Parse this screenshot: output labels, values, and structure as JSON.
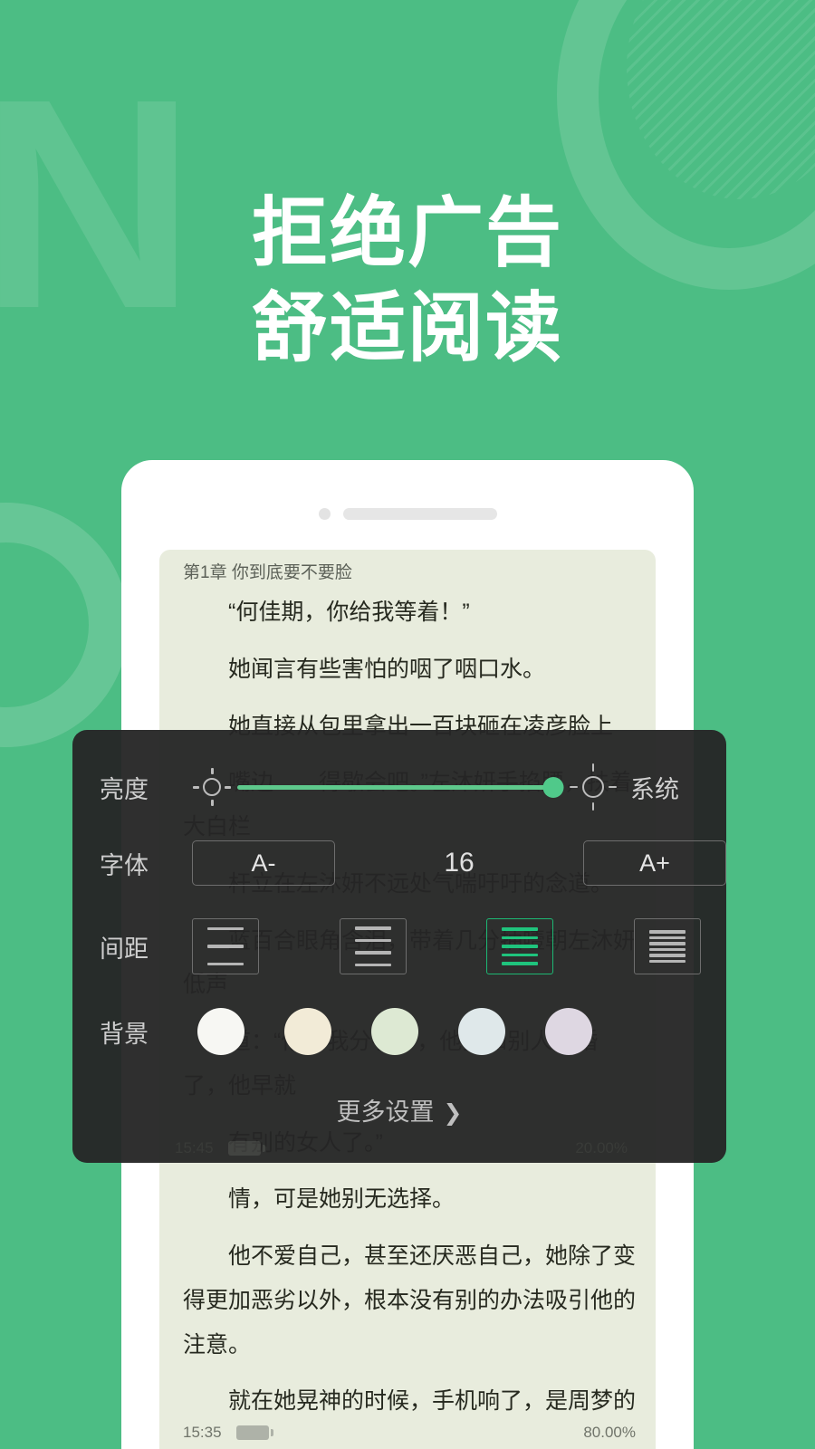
{
  "promo": {
    "headline_line1": "拒绝广告",
    "headline_line2": "舒适阅读",
    "background_color": "#4cbd84",
    "deco_letter": "N"
  },
  "reader": {
    "chapter_title": "第1章 你到底要不要脸",
    "paragraphs_top": [
      "“何佳期，你给我等着！”",
      "她闻言有些害怕的咽了咽口水。",
      "她直接从包里拿出一百块砸在凌彦脸上"
    ],
    "paragraphs_hidden": [
      "嘴边……得歇会吧。”左沐妍手掐腰，扶着大白栏",
      "杆立在左沐妍不远处气喘吁吁的念道。",
      "蓝百合眼角含泪，带着几分抽噎朝左沐妍低声",
      "道：“他和我分手了，他要和别人结婚了，他早就",
      "有别的女人了。”"
    ],
    "paragraphs_bottom": [
      "情，可是她别无选择。",
      "他不爱自己，甚至还厌恶自己，她除了变得更加恶劣以外，根本没有别的办法吸引他的注意。",
      "就在她晃神的时候，手机响了，是周梦的"
    ],
    "status": {
      "time": "15:35",
      "progress": "80.00%",
      "battery_icon": "battery-icon"
    },
    "ghost_status": {
      "time": "15:45",
      "progress": "20.00%"
    },
    "page_background_color": "#e8ecdd"
  },
  "settings_panel": {
    "brightness": {
      "label": "亮度",
      "low_icon": "sun-small-icon",
      "high_icon": "sun-large-icon",
      "value_percent": 97,
      "mode_label": "系统",
      "fill_color": "#5ec98c"
    },
    "font": {
      "label": "字体",
      "decrease_label": "A-",
      "increase_label": "A+",
      "size_value": "16"
    },
    "spacing": {
      "label": "间距",
      "options": [
        {
          "name": "spacing-loose",
          "lines": 3,
          "selected": false
        },
        {
          "name": "spacing-normal",
          "lines": 4,
          "selected": false
        },
        {
          "name": "spacing-tight",
          "lines": 5,
          "selected": true
        },
        {
          "name": "spacing-tightest",
          "lines": 6,
          "selected": false
        }
      ],
      "selected_color": "#1db874"
    },
    "background": {
      "label": "背景",
      "swatches": [
        {
          "name": "theme-white",
          "color": "#f7f7f3"
        },
        {
          "name": "theme-cream",
          "color": "#f2ebd7"
        },
        {
          "name": "theme-green",
          "color": "#dde9d3"
        },
        {
          "name": "theme-blue",
          "color": "#dfe8ea"
        },
        {
          "name": "theme-purple",
          "color": "#ded7e2"
        }
      ]
    },
    "more_settings_label": "更多设置",
    "more_settings_chevron": "›"
  }
}
